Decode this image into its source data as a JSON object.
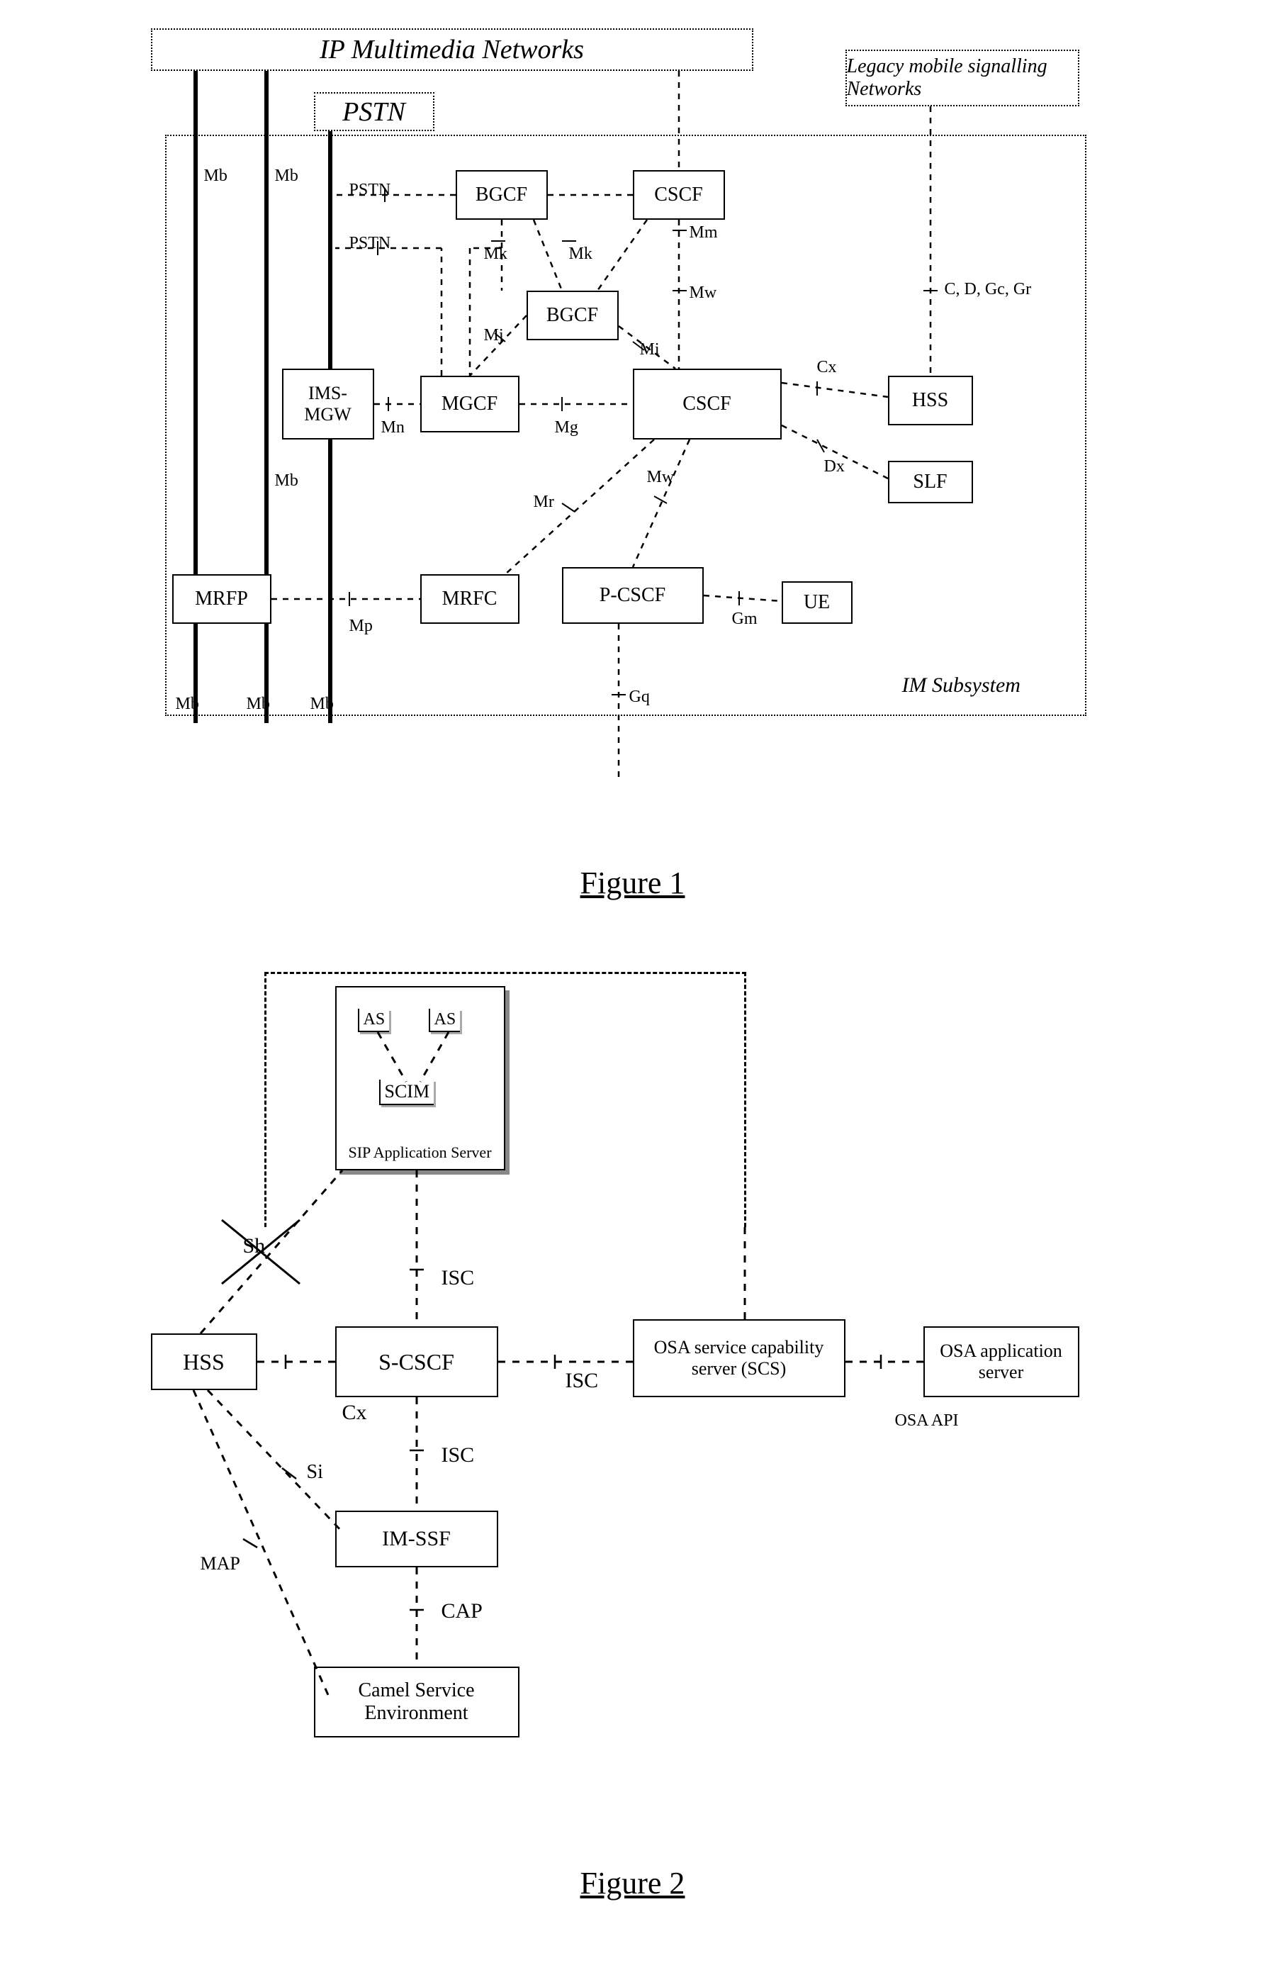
{
  "fig1": {
    "title_ip": "IP Multimedia Networks",
    "title_pstn": "PSTN",
    "title_legacy": "Legacy mobile signalling Networks",
    "im_subsystem": "IM Subsystem",
    "nodes": {
      "bgcf1": "BGCF",
      "cscf_top": "CSCF",
      "bgcf2": "BGCF",
      "ims_mgw": "IMS-MGW",
      "mgcf": "MGCF",
      "cscf_main": "CSCF",
      "hss": "HSS",
      "slf": "SLF",
      "mrfp": "MRFP",
      "mrfc": "MRFC",
      "pcscf": "P-CSCF",
      "ue": "UE"
    },
    "ifaces": {
      "mb": "Mb",
      "pstn": "PSTN",
      "mk": "Mk",
      "mm": "Mm",
      "mj": "Mj",
      "mi": "Mi",
      "mw": "Mw",
      "cx": "Cx",
      "cdgcgr": "C, D, Gc, Gr",
      "mn": "Mn",
      "mg": "Mg",
      "mr": "Mr",
      "dx": "Dx",
      "gm": "Gm",
      "mp": "Mp",
      "gq": "Gq"
    },
    "caption": "Figure 1"
  },
  "fig2": {
    "nodes": {
      "as1": "AS",
      "as2": "AS",
      "scim": "SCIM",
      "sip_as": "SIP Application Server",
      "hss": "HSS",
      "scscf": "S-CSCF",
      "osa_scs": "OSA service capability server (SCS)",
      "osa_as": "OSA application server",
      "osa_api": "OSA API",
      "imssf": "IM-SSF",
      "camel": "Camel Service Environment"
    },
    "ifaces": {
      "sh": "Sh",
      "isc": "ISC",
      "cx": "Cx",
      "si": "Si",
      "map": "MAP",
      "cap": "CAP"
    },
    "caption": "Figure 2"
  }
}
